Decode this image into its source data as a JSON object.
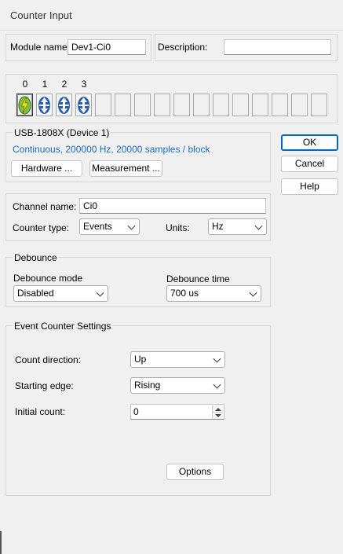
{
  "window": {
    "title": "Counter Input"
  },
  "module": {
    "name_label": "Module name:",
    "name_value": "Dev1-Ci0",
    "description_label": "Description:",
    "description_value": ""
  },
  "channels": {
    "numbers": [
      "0",
      "1",
      "2",
      "3"
    ],
    "slots": [
      {
        "icon": "lightning-icon",
        "state": "selected"
      },
      {
        "icon": "counter-arrows-icon",
        "state": "filled"
      },
      {
        "icon": "counter-arrows-icon",
        "state": "filled"
      },
      {
        "icon": "counter-arrows-icon",
        "state": "filled"
      },
      {
        "state": "empty"
      },
      {
        "state": "empty"
      },
      {
        "state": "empty"
      },
      {
        "state": "empty"
      },
      {
        "state": "empty"
      },
      {
        "state": "empty"
      },
      {
        "state": "empty"
      },
      {
        "state": "empty"
      },
      {
        "state": "empty"
      },
      {
        "state": "empty"
      },
      {
        "state": "empty"
      },
      {
        "state": "empty"
      }
    ],
    "colors": {
      "lightning_fill": "#7ec242",
      "lightning_bolt": "#f5e000",
      "arrow_fill": "#2a5db0"
    }
  },
  "device": {
    "title": "USB-1808X (Device 1)",
    "info": "Continuous, 200000 Hz, 20000 samples / block",
    "info_color": "#1a6bc4",
    "hardware_button": "Hardware ...",
    "measurement_button": "Measurement ..."
  },
  "actions": {
    "ok": "OK",
    "cancel": "Cancel",
    "help": "Help"
  },
  "channel": {
    "name_label": "Channel name:",
    "name_value": "Ci0",
    "counter_type_label": "Counter type:",
    "counter_type_value": "Events",
    "units_label": "Units:",
    "units_value": "Hz"
  },
  "debounce": {
    "title": "Debounce",
    "mode_label": "Debounce mode",
    "mode_value": "Disabled",
    "time_label": "Debounce time",
    "time_value": "700 us"
  },
  "event_settings": {
    "title": "Event Counter Settings",
    "direction_label": "Count direction:",
    "direction_value": "Up",
    "edge_label": "Starting edge:",
    "edge_value": "Rising",
    "initial_label": "Initial count:",
    "initial_value": "0",
    "options_button": "Options"
  }
}
